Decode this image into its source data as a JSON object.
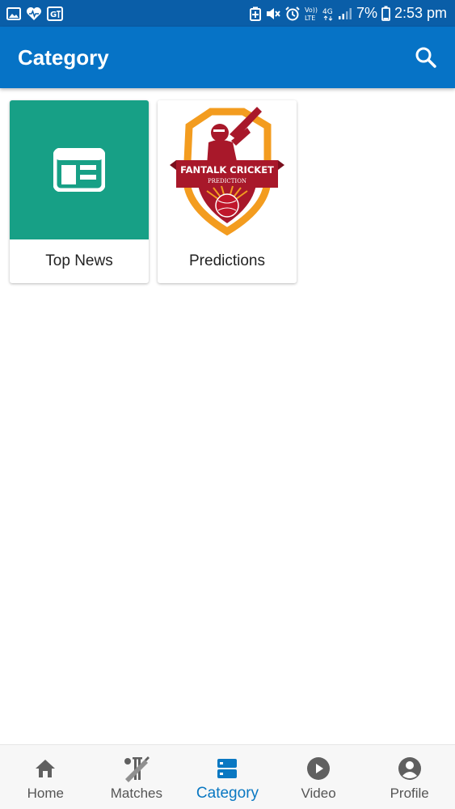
{
  "status_bar": {
    "battery": "7%",
    "time": "2:53 pm",
    "network": "4G",
    "volte": "Vo)) LTE"
  },
  "app_bar": {
    "title": "Category",
    "search_icon": "search-icon"
  },
  "categories": [
    {
      "label": "Top News",
      "icon": "newspaper-icon",
      "color": "#17a086"
    },
    {
      "label": "Predictions",
      "icon": "fantalk-cricket-logo",
      "logo_text": "FANTALK CRICKET",
      "logo_subtext": "PREDICTION"
    }
  ],
  "bottom_nav": {
    "active": "Category",
    "items": [
      {
        "label": "Home",
        "icon": "home-icon"
      },
      {
        "label": "Matches",
        "icon": "cricket-icon"
      },
      {
        "label": "Category",
        "icon": "category-icon"
      },
      {
        "label": "Video",
        "icon": "play-icon"
      },
      {
        "label": "Profile",
        "icon": "account-icon"
      }
    ]
  },
  "colors": {
    "status_bar": "#0a5ea8",
    "app_bar": "#0673c6",
    "accent": "#0a78c2",
    "news_tile": "#17a086"
  }
}
